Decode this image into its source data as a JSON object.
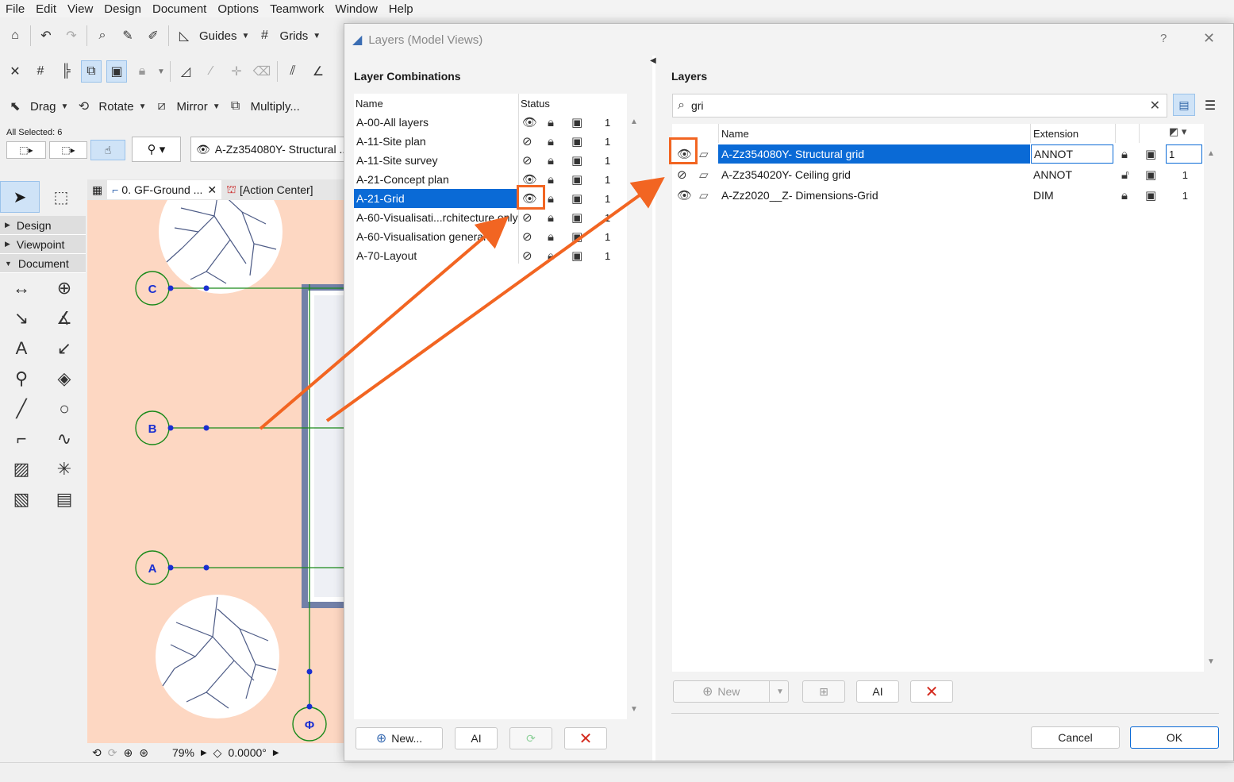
{
  "menu": [
    "File",
    "Edit",
    "View",
    "Design",
    "Document",
    "Options",
    "Teamwork",
    "Window",
    "Help"
  ],
  "toolbar": {
    "guides_label": "Guides",
    "grids_label": "Grids",
    "drag_label": "Drag",
    "rotate_label": "Rotate",
    "mirror_label": "Mirror",
    "multiply_label": "Multiply...",
    "all_selected": "All Selected: 6",
    "layer_field": "A-Zz354080Y- Structural ..."
  },
  "toolbox": {
    "sections": [
      "Design",
      "Viewpoint",
      "Document"
    ]
  },
  "canvas": {
    "tabs": [
      "0. GF-Ground ...",
      "[Action Center]"
    ],
    "grid_markers": [
      "C",
      "B",
      "A",
      "Φ"
    ],
    "zoom": "79%",
    "angle": "0.0000°"
  },
  "dialog": {
    "title": "Layers (Model Views)",
    "help": "?",
    "combinations": {
      "heading": "Layer Combinations",
      "col_name": "Name",
      "col_status": "Status",
      "items": [
        {
          "name": "A-00-All layers",
          "visible": true,
          "num": "1"
        },
        {
          "name": "A-11-Site plan",
          "visible": false,
          "num": "1"
        },
        {
          "name": "A-11-Site survey",
          "visible": false,
          "num": "1"
        },
        {
          "name": "A-21-Concept plan",
          "visible": true,
          "num": "1"
        },
        {
          "name": "A-21-Grid",
          "visible": true,
          "num": "1",
          "selected": true
        },
        {
          "name": "A-60-Visualisati...rchitecture only",
          "visible": false,
          "num": "1"
        },
        {
          "name": "A-60-Visualisation general",
          "visible": false,
          "num": "1"
        },
        {
          "name": "A-70-Layout",
          "visible": false,
          "num": "1"
        }
      ],
      "btn_new": "New...",
      "btn_rename": "AΙ"
    },
    "layers": {
      "heading": "Layers",
      "search_value": "gri",
      "col_name": "Name",
      "col_extension": "Extension",
      "items": [
        {
          "name": "A-Zz354080Y- Structural grid",
          "ext": "ANNOT",
          "visible": true,
          "locked": true,
          "num": "1",
          "selected": true
        },
        {
          "name": "A-Zz354020Y- Ceiling grid",
          "ext": "ANNOT",
          "visible": false,
          "locked": false,
          "num": "1"
        },
        {
          "name": "A-Zz2020__Z- Dimensions-Grid",
          "ext": "DIM",
          "visible": true,
          "locked": true,
          "num": "1"
        }
      ],
      "btn_new": "New",
      "btn_rename": "AΙ"
    },
    "cancel": "Cancel",
    "ok": "OK"
  },
  "colors": {
    "accent": "#0a6ad6",
    "annotation": "#f26522",
    "canvas_bg": "#fdd7c2",
    "delete": "#d42a1e"
  }
}
